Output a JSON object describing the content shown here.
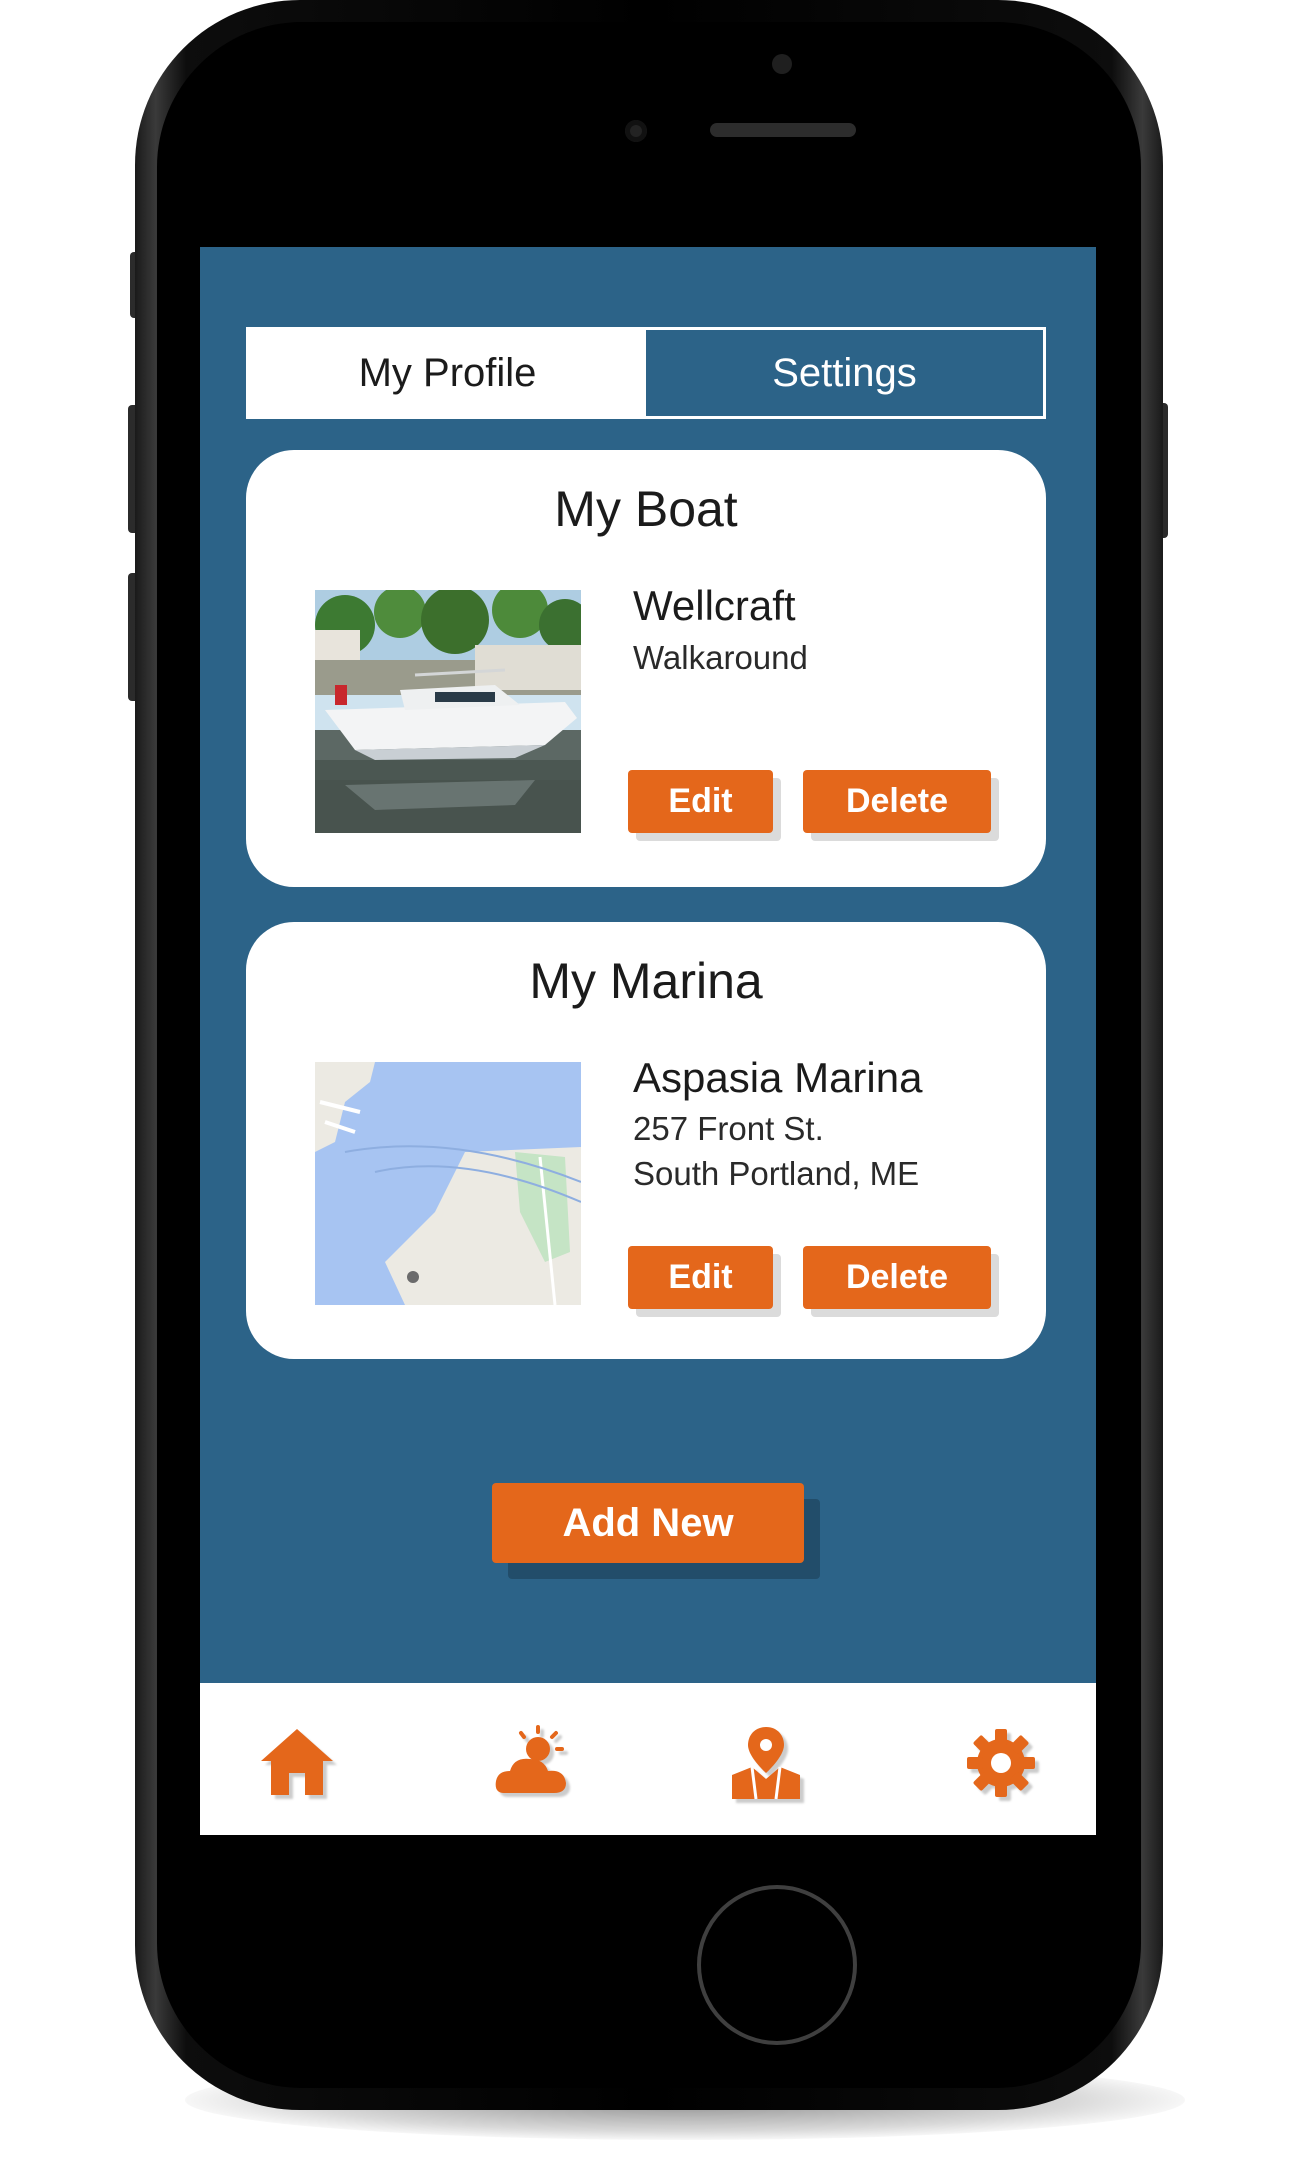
{
  "tabs": [
    {
      "label": "My Profile",
      "active": true
    },
    {
      "label": "Settings",
      "active": false
    }
  ],
  "boat": {
    "title": "My Boat",
    "name": "Wellcraft",
    "model": "Walkaround",
    "edit_label": "Edit",
    "delete_label": "Delete"
  },
  "marina": {
    "title": "My Marina",
    "name": "Aspasia Marina",
    "address_line1": "257 Front St.",
    "address_line2": "South Portland, ME",
    "edit_label": "Edit",
    "delete_label": "Delete"
  },
  "add_new_label": "Add New",
  "nav": [
    {
      "icon": "home-icon"
    },
    {
      "icon": "weather-icon"
    },
    {
      "icon": "map-location-icon"
    },
    {
      "icon": "gear-icon"
    }
  ],
  "colors": {
    "background": "#2c6388",
    "accent": "#e4671b",
    "card": "#ffffff"
  }
}
